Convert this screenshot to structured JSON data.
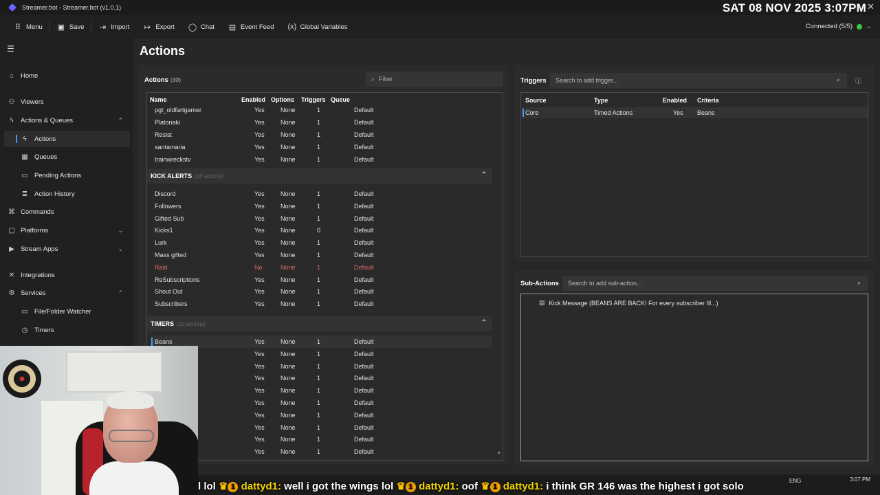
{
  "window": {
    "title": "Streamer.bot - Streamer.bot (v1.0.1)",
    "clock": "SAT 08 NOV 2025 3:07PM",
    "close_icon": "close-icon"
  },
  "toolbar": {
    "menu": "Menu",
    "save": "Save",
    "import": "Import",
    "export": "Export",
    "chat": "Chat",
    "event_feed": "Event Feed",
    "global_variables": "Global Variables",
    "connected": "Connected (5/5)",
    "status_color": "#3cc43c"
  },
  "sidebar": {
    "home": "Home",
    "viewers": "Viewers",
    "actions_queues": "Actions & Queues",
    "actions": "Actions",
    "queues": "Queues",
    "pending_actions": "Pending Actions",
    "action_history": "Action History",
    "commands": "Commands",
    "platforms": "Platforms",
    "stream_apps": "Stream Apps",
    "integrations": "Integrations",
    "services": "Services",
    "file_folder_watcher": "File/Folder Watcher",
    "timers": "Timers"
  },
  "page": {
    "title": "Actions"
  },
  "actions_panel": {
    "title": "Actions",
    "count": "(30)",
    "filter_placeholder": "Filter",
    "columns": {
      "name": "Name",
      "enabled": "Enabled",
      "options": "Options",
      "triggers": "Triggers",
      "queue": "Queue"
    },
    "top_rows": [
      {
        "name": "pgt_oldfartgamer",
        "enabled": "Yes",
        "options": "None",
        "triggers": "1",
        "queue": "Default"
      },
      {
        "name": "Platonaki",
        "enabled": "Yes",
        "options": "None",
        "triggers": "1",
        "queue": "Default"
      },
      {
        "name": "Resist",
        "enabled": "Yes",
        "options": "None",
        "triggers": "1",
        "queue": "Default"
      },
      {
        "name": "santamaria",
        "enabled": "Yes",
        "options": "None",
        "triggers": "1",
        "queue": "Default"
      },
      {
        "name": "trainwreckstv",
        "enabled": "Yes",
        "options": "None",
        "triggers": "1",
        "queue": "Default"
      }
    ],
    "kick_alerts": {
      "name": "KICK ALERTS",
      "count": "(10 actions)",
      "rows": [
        {
          "name": "Discord",
          "enabled": "Yes",
          "options": "None",
          "triggers": "1",
          "queue": "Default"
        },
        {
          "name": "Followers",
          "enabled": "Yes",
          "options": "None",
          "triggers": "1",
          "queue": "Default"
        },
        {
          "name": "Gifted Sub",
          "enabled": "Yes",
          "options": "None",
          "triggers": "1",
          "queue": "Default"
        },
        {
          "name": "Kicks1",
          "enabled": "Yes",
          "options": "None",
          "triggers": "0",
          "queue": "Default"
        },
        {
          "name": "Lurk",
          "enabled": "Yes",
          "options": "None",
          "triggers": "1",
          "queue": "Default"
        },
        {
          "name": "Mass gifted",
          "enabled": "Yes",
          "options": "None",
          "triggers": "1",
          "queue": "Default"
        },
        {
          "name": "Raid",
          "enabled": "No",
          "options": "None",
          "triggers": "1",
          "queue": "Default"
        },
        {
          "name": "ReSubscriptions",
          "enabled": "Yes",
          "options": "None",
          "triggers": "1",
          "queue": "Default"
        },
        {
          "name": "Shout Out",
          "enabled": "Yes",
          "options": "None",
          "triggers": "1",
          "queue": "Default"
        },
        {
          "name": "Subscribers",
          "enabled": "Yes",
          "options": "None",
          "triggers": "1",
          "queue": "Default"
        }
      ]
    },
    "timers": {
      "name": "TIMERS",
      "count": "(10 actions)",
      "rows": [
        {
          "name": "Beans",
          "enabled": "Yes",
          "options": "None",
          "triggers": "1",
          "queue": "Default"
        },
        {
          "name": "",
          "enabled": "Yes",
          "options": "None",
          "triggers": "1",
          "queue": "Default"
        },
        {
          "name": "",
          "enabled": "Yes",
          "options": "None",
          "triggers": "1",
          "queue": "Default"
        },
        {
          "name": "",
          "enabled": "Yes",
          "options": "None",
          "triggers": "1",
          "queue": "Default"
        },
        {
          "name": "",
          "enabled": "Yes",
          "options": "None",
          "triggers": "1",
          "queue": "Default"
        },
        {
          "name": "",
          "enabled": "Yes",
          "options": "None",
          "triggers": "1",
          "queue": "Default"
        },
        {
          "name": "",
          "enabled": "Yes",
          "options": "None",
          "triggers": "1",
          "queue": "Default"
        },
        {
          "name": "",
          "enabled": "Yes",
          "options": "None",
          "triggers": "1",
          "queue": "Default"
        },
        {
          "name": "",
          "enabled": "Yes",
          "options": "None",
          "triggers": "1",
          "queue": "Default"
        },
        {
          "name": "",
          "enabled": "Yes",
          "options": "None",
          "triggers": "1",
          "queue": "Default"
        }
      ]
    }
  },
  "triggers_panel": {
    "title": "Triggers",
    "search_placeholder": "Search to add trigger...",
    "columns": {
      "source": "Source",
      "type": "Type",
      "enabled": "Enabled",
      "criteria": "Criteria"
    },
    "row": {
      "source": "Core",
      "type": "Timed Actions",
      "enabled": "Yes",
      "criteria": "Beans"
    }
  },
  "subactions_panel": {
    "title": "Sub-Actions",
    "search_placeholder": "Search to add sub-action...",
    "item": "Kick Message (BEANS ARE BACK! For every subscriber Ill...)"
  },
  "overlay": {
    "ticker_1": "l lol",
    "user_1": "dattyd1:",
    "msg_1": "well i got the wings lol",
    "user_2": "dattyd1:",
    "msg_2": "oof",
    "user_3": "dattyd1:",
    "msg_3": "i think GR 146 was the highest i got solo",
    "badge": "1",
    "tray_lang": "ENG",
    "tray_time": "3:07 PM"
  }
}
